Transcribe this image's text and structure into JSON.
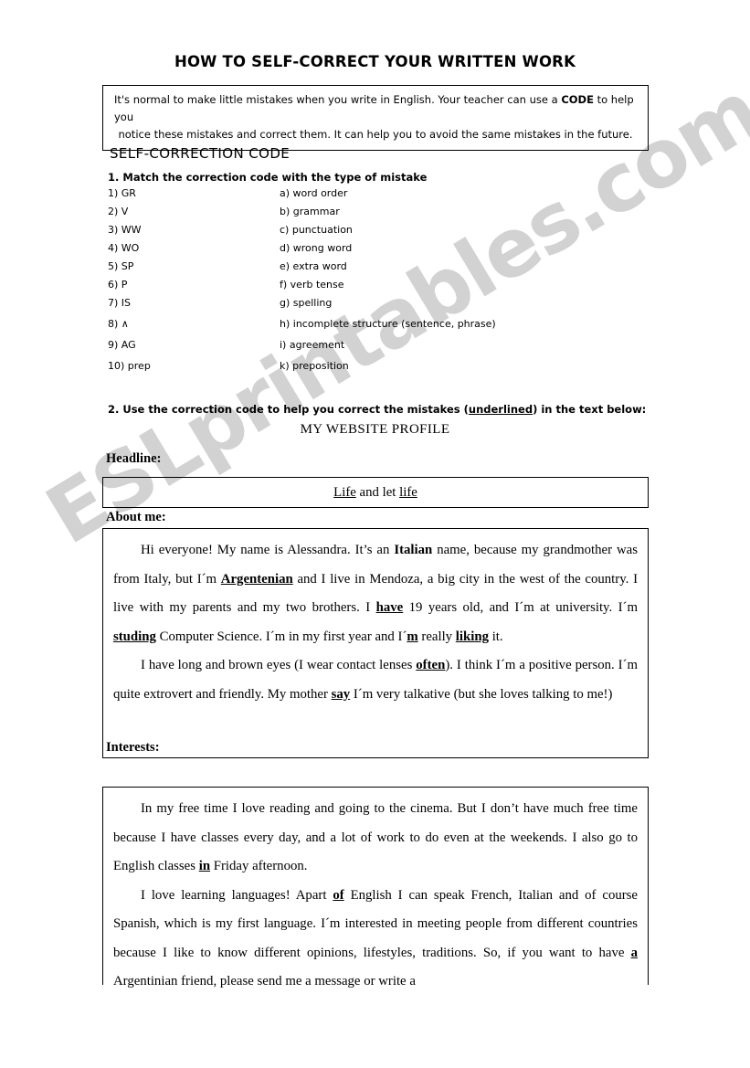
{
  "document": {
    "title": "HOW TO SELF-CORRECT YOUR WRITTEN WORK",
    "intro_line_1": "It's normal to make little mistakes when you write in English. Your teacher can use a CODE to help you",
    "intro_line_1_a": "It's normal to make little mistakes when you write in English. Your teacher can use a ",
    "intro_code_word": "CODE",
    "intro_line_1_b": " to help you",
    "intro_line_2": "notice these mistakes and correct them. It can help you to avoid the same mistakes in the future.",
    "section_heading": "SELF-CORRECTION CODE",
    "watermark": "ESLprintables.com",
    "watermark_color": "#d2d2d2"
  },
  "task1": {
    "instruction": "1. Match the correction code with the type of mistake",
    "rows": [
      {
        "code": "1) GR",
        "type": "a) word order"
      },
      {
        "code": "2) V",
        "type": "b) grammar"
      },
      {
        "code": "3) WW",
        "type": "c) punctuation"
      },
      {
        "code": "4) WO",
        "type": "d) wrong word"
      },
      {
        "code": "5) SP",
        "type": "e) extra word"
      },
      {
        "code": "6) P",
        "type": "f) verb tense"
      },
      {
        "code": "7) IS",
        "type": "g) spelling"
      },
      {
        "code": "8) ∧",
        "type": "h) incomplete structure (sentence, phrase)"
      },
      {
        "code": "9) AG",
        "type": "i) agreement"
      },
      {
        "code": "10) prep",
        "type": "k) preposition"
      }
    ]
  },
  "task2": {
    "instruction_a": "2. Use the correction code to help you correct the mistakes (",
    "instruction_underlined": "underlined",
    "instruction_b": ") in the text below:",
    "profile_title": "MY WEBSITE PROFILE",
    "headline_label": "Headline:",
    "headline": {
      "word1": "Life",
      "middle": " and let ",
      "word2": "life"
    },
    "about_label": "About me:",
    "about": {
      "p1": {
        "s1": "Hi everyone! My name is Alessandra. It’s an ",
        "e1": "Italian",
        "s2": " name, because my grandmother was from Italy, but I´m ",
        "e2": "Argentenian",
        "s3": " and I live in Mendoza, a big city in the west of the country. I live with my parents and my two brothers. I ",
        "e3": "have",
        "s4": " 19 years old, and I´m at university. I´m ",
        "e4": "studing",
        "s5": " Computer Science. I´m in my first year and I´",
        "e5": "m",
        "s6": " really ",
        "e6": "liking",
        "s7": " it."
      },
      "p2": {
        "s1": "I have long and brown eyes (I wear contact lenses ",
        "e1": "often",
        "s2": "). I think I´m a positive person. I´m quite extrovert and friendly. My mother ",
        "e2": "say",
        "s3": " I´m very talkative (but she loves talking to me!)"
      }
    },
    "interests_label": "Interests:",
    "interests": {
      "p1": {
        "s1": "In my free time I love reading and going to the cinema. But I don’t have much free time because I have classes every day, and a lot of work to do even at the weekends. I also go to English classes ",
        "e1": "in",
        "s2": " Friday afternoon."
      },
      "p2": {
        "s1": "I love learning languages! Apart ",
        "e1": "of",
        "s2": " English I can speak French, Italian and of course Spanish, which is my first language. I´m interested in meeting people from different countries because I like to know different opinions, lifestyles, traditions. So, if you want to have ",
        "e2": "a",
        "s3": " Argentinian friend, please send me a message or write a"
      }
    }
  }
}
